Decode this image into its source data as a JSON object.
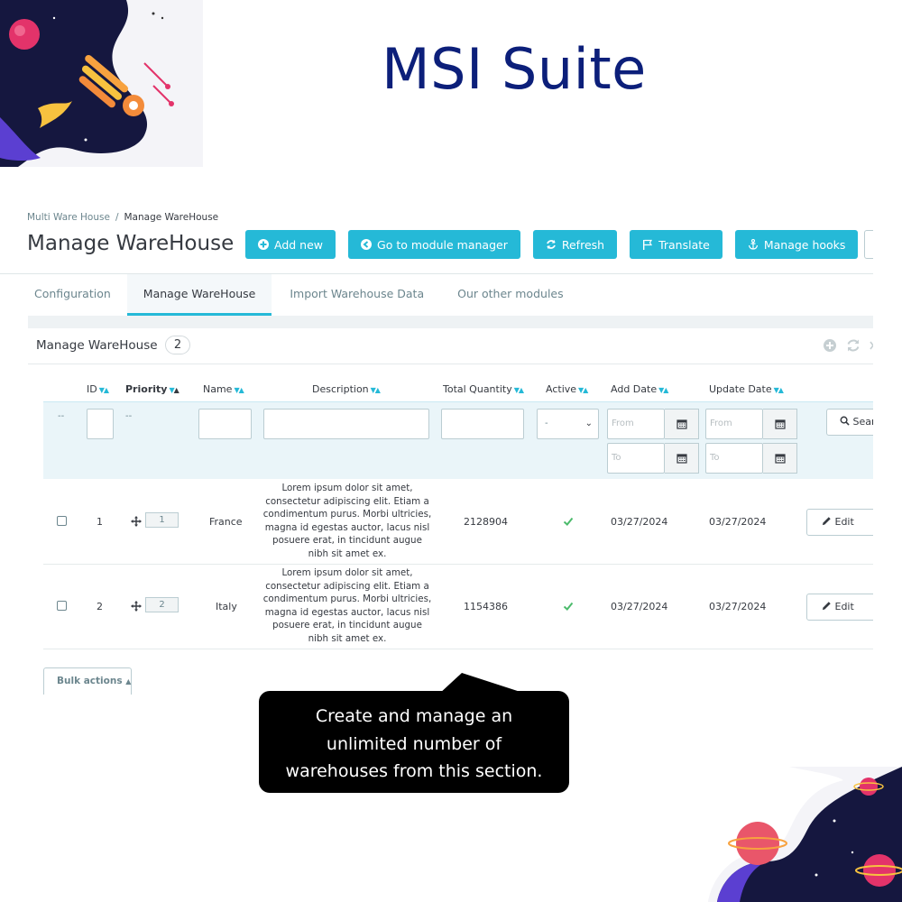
{
  "banner": {
    "title": "MSI Suite"
  },
  "breadcrumb": {
    "parent": "Multi Ware House",
    "separator": "/",
    "current": "Manage WareHouse"
  },
  "page_title": "Manage WareHouse",
  "toolbar": [
    {
      "label": "Add new",
      "icon": "plus-circle-icon"
    },
    {
      "label": "Go to module manager",
      "icon": "arrow-left-circle-icon"
    },
    {
      "label": "Refresh",
      "icon": "refresh-icon"
    },
    {
      "label": "Translate",
      "icon": "flag-icon"
    },
    {
      "label": "Manage hooks",
      "icon": "anchor-icon"
    }
  ],
  "tabs": [
    {
      "label": "Configuration",
      "active": false
    },
    {
      "label": "Manage WareHouse",
      "active": true
    },
    {
      "label": "Import Warehouse Data",
      "active": false
    },
    {
      "label": "Our other modules",
      "active": false
    }
  ],
  "panel": {
    "title": "Manage WareHouse",
    "count": "2"
  },
  "table": {
    "headers": {
      "id": "ID",
      "priority": "Priority",
      "name": "Name",
      "description": "Description",
      "total_quantity": "Total Quantity",
      "active": "Active",
      "add_date": "Add Date",
      "update_date": "Update Date"
    },
    "filters": {
      "checkbox_dash": "--",
      "priority_dash": "--",
      "active_select": "-",
      "from_placeholder": "From",
      "to_placeholder": "To",
      "search_label": "Search"
    },
    "rows": [
      {
        "id": "1",
        "position": "1",
        "name": "France",
        "description": "Lorem ipsum dolor sit amet, consectetur adipiscing elit. Etiam a condimentum purus. Morbi ultricies, magna id egestas auctor, lacus nisl posuere erat, in tincidunt augue nibh sit amet ex.",
        "total_quantity": "2128904",
        "active": true,
        "add_date": "03/27/2024",
        "update_date": "03/27/2024",
        "edit_label": "Edit"
      },
      {
        "id": "2",
        "position": "2",
        "name": "Italy",
        "description": "Lorem ipsum dolor sit amet, consectetur adipiscing elit. Etiam a condimentum purus. Morbi ultricies, magna id egestas auctor, lacus nisl posuere erat, in tincidunt augue nibh sit amet ex.",
        "total_quantity": "1154386",
        "active": true,
        "add_date": "03/27/2024",
        "update_date": "03/27/2024",
        "edit_label": "Edit"
      }
    ],
    "bulk_actions": "Bulk actions"
  },
  "callout": {
    "line1": "Create and manage an",
    "line2": "unlimited number of",
    "line3": "warehouses from this section."
  },
  "colors": {
    "accent": "#25b9d7",
    "title": "#0c1f7a",
    "success": "#4cbb6c"
  }
}
